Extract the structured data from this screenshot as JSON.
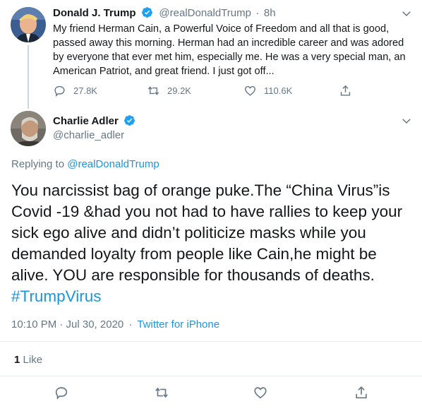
{
  "colors": {
    "link": "#1b95e0",
    "verified": "#1da1f2",
    "secondary_text": "#657786",
    "divider": "#e6ecf0"
  },
  "original_tweet": {
    "display_name": "Donald J. Trump",
    "handle": "@realDonaldTrump",
    "separator": "·",
    "age": "8h",
    "text": "My friend Herman Cain, a Powerful Voice of Freedom and all that is good, passed away this morning. Herman had an incredible career and was adored by everyone that ever met him, especially me. He was a very special man, an American Patriot, and great friend. I just got off...",
    "reply_count": "27.8K",
    "retweet_count": "29.2K",
    "like_count": "110.6K",
    "icons": [
      "chevron-down-icon",
      "verified-icon",
      "reply-icon",
      "retweet-icon",
      "like-icon",
      "share-icon"
    ]
  },
  "reply_tweet": {
    "display_name": "Charlie Adler",
    "handle": "@charlie_adler",
    "replying_to_label": "Replying to",
    "replying_to_handle": "@realDonaldTrump",
    "text": "You narcissist bag of orange puke.The “China Virus”is Covid -19 &had you not had to have rallies to keep your sick ego alive and didn’t politicize masks while you demanded loyalty from people like Cain,he might be alive. YOU are responsible for thousands of deaths.",
    "hashtag": "#TrumpVirus",
    "timestamp": "10:10 PM · Jul 30, 2020",
    "meta_separator": "·",
    "source": "Twitter for iPhone",
    "like_count": "1",
    "like_label": "Like",
    "icons": [
      "chevron-down-icon",
      "verified-icon",
      "reply-icon",
      "retweet-icon",
      "like-icon",
      "share-icon"
    ]
  }
}
